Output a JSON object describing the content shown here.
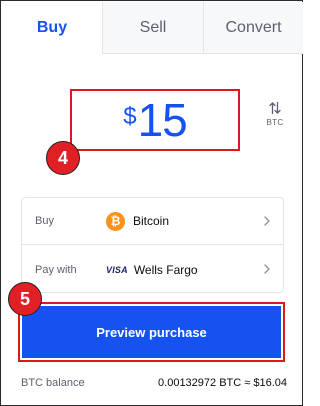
{
  "tabs": [
    {
      "label": "Buy",
      "active": true
    },
    {
      "label": "Sell",
      "active": false
    },
    {
      "label": "Convert",
      "active": false
    }
  ],
  "amount": {
    "currency_symbol": "$",
    "value": "15"
  },
  "swap": {
    "label": "BTC",
    "icon": "swap-vertical-icon"
  },
  "annotations": {
    "step_amount": "4",
    "step_preview": "5",
    "highlight_color": "#d81b1b"
  },
  "asset_selector": {
    "buy_label": "Buy",
    "asset_name": "Bitcoin",
    "asset_icon_glyph": "₿",
    "pay_label": "Pay with",
    "payment_brand": "VISA",
    "payment_method": "Wells Fargo"
  },
  "preview_button": {
    "label": "Preview purchase"
  },
  "balance": {
    "label": "BTC balance",
    "value": "0.00132972 BTC  ≈ $16.04"
  },
  "colors": {
    "accent": "#1652f0",
    "bitcoin": "#f7931a",
    "muted": "#5b616e"
  }
}
